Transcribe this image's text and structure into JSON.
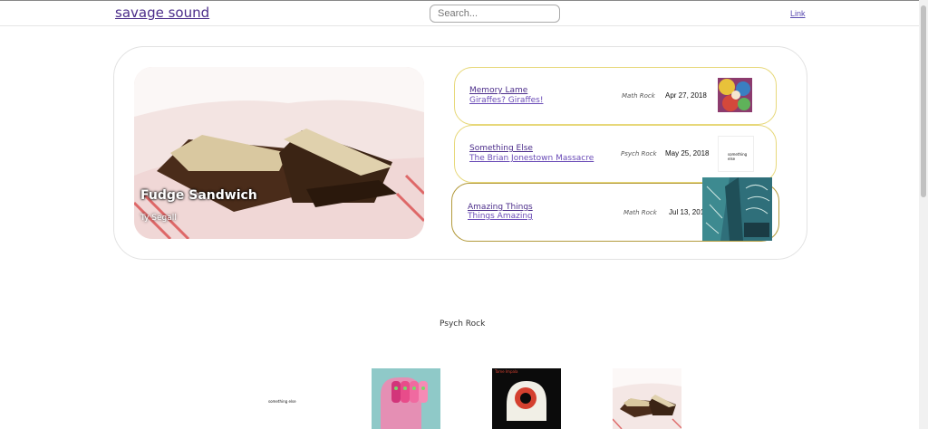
{
  "navbar": {
    "brand": "savage sound",
    "search_placeholder": "Search...",
    "link_label": "Link"
  },
  "featured": {
    "hero": {
      "title": "Fudge Sandwich",
      "artist": "Ty Segall"
    },
    "tracks": [
      {
        "title": "Memory Lame",
        "artist": "Giraffes? Giraffes!",
        "genre": "Math Rock",
        "date": "Apr 27, 2018",
        "cover_icon": "psychedelic-collage-cover"
      },
      {
        "title": "Something Else",
        "artist": "The Brian Jonestown Massacre",
        "genre": "Psych Rock",
        "date": "May 25, 2018",
        "cover_icon": "white-minimal-cover",
        "cover_text": "something else"
      },
      {
        "title": "Amazing Things",
        "artist": "Things Amazing",
        "genre": "Math Rock",
        "date": "Jul 13, 2018",
        "cover_icon": "teal-illustrated-cover"
      }
    ]
  },
  "genre_section": {
    "title": "Psych Rock",
    "thumbnails": [
      {
        "icon": "white-minimal-cover",
        "text": "something else"
      },
      {
        "icon": "pink-faces-cover"
      },
      {
        "icon": "black-head-cover",
        "text": "Tame Impala"
      },
      {
        "icon": "sandwich-photo-cover"
      }
    ]
  },
  "colors": {
    "brand": "#4b2c8a",
    "track_border": "#e7d87a",
    "track_border_active": "#b39a3c"
  }
}
